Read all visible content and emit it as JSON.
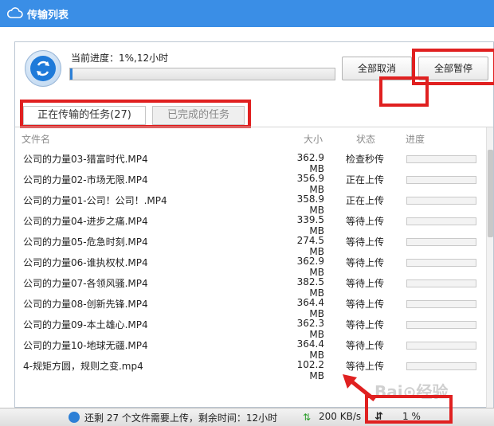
{
  "window": {
    "title": "传输列表",
    "accent_color": "#3a8ee6"
  },
  "overall": {
    "progress_label": "当前进度：1%,12小时",
    "progress_fraction": 0.01,
    "cancel_all_label": "全部取消",
    "pause_all_label": "全部暂停"
  },
  "tabs": {
    "uploading_label": "正在传输的任务(27)",
    "completed_label": "已完成的任务"
  },
  "list": {
    "columns": {
      "name": "文件名",
      "size": "大小",
      "status": "状态",
      "progress": "进度"
    },
    "rows": [
      {
        "name": "公司的力量03-猎富时代.MP4",
        "size": "362.9 MB",
        "status": "检查秒传"
      },
      {
        "name": "公司的力量02-市场无限.MP4",
        "size": "356.9 MB",
        "status": "正在上传"
      },
      {
        "name": "公司的力量01-公司！公司！.MP4",
        "size": "358.9 MB",
        "status": "正在上传"
      },
      {
        "name": "公司的力量04-进步之痛.MP4",
        "size": "339.5 MB",
        "status": "等待上传"
      },
      {
        "name": "公司的力量05-危急时刻.MP4",
        "size": "274.5 MB",
        "status": "等待上传"
      },
      {
        "name": "公司的力量06-谁执权杖.MP4",
        "size": "362.9 MB",
        "status": "等待上传"
      },
      {
        "name": "公司的力量07-各领风骚.MP4",
        "size": "382.5 MB",
        "status": "等待上传"
      },
      {
        "name": "公司的力量08-创新先锋.MP4",
        "size": "364.4 MB",
        "status": "等待上传"
      },
      {
        "name": "公司的力量09-本土雄心.MP4",
        "size": "362.3 MB",
        "status": "等待上传"
      },
      {
        "name": "公司的力量10-地球无疆.MP4",
        "size": "364.4 MB",
        "status": "等待上传"
      },
      {
        "name": "4-规矩方圆，规则之变.mp4",
        "size": "102.2 MB",
        "status": "等待上传"
      }
    ]
  },
  "status_bar": {
    "summary": "还剩 27 个文件需要上传，剩余时间：12小时",
    "speed": "200 KB/s",
    "percent": "1 %"
  }
}
